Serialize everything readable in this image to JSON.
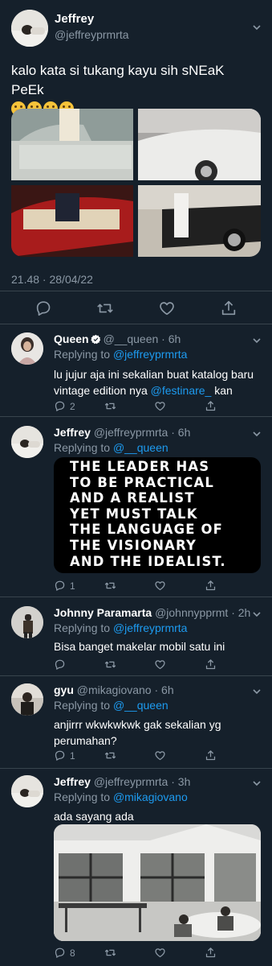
{
  "main_tweet": {
    "name": "Jeffrey",
    "handle": "@jeffreyprmrta",
    "text": "kalo kata si tukang kayu sih sNEaK PeEk",
    "emoji_count": 4,
    "emoji": "grimacing-hand-over-mouth",
    "timestamp": "21.48 · 28/04/22",
    "actions": [
      "reply-icon",
      "retweet-icon",
      "like-icon",
      "share-icon"
    ]
  },
  "replies": [
    {
      "name": "Queen",
      "verified": true,
      "meta": "@__queen · 6h",
      "replying_prefix": "Replying to",
      "replying_to": "@jeffreyprmrta",
      "text_before": "lu jujur aja ini sekalian buat katalog baru vintage edition nya ",
      "mention": "@festinare_",
      "text_after": " kan",
      "reply_count": "2",
      "retweet_count": "",
      "like_count": ""
    },
    {
      "name": "Jeffrey",
      "meta": "@jeffreyprmrta · 6h",
      "replying_prefix": "Replying to",
      "replying_to": "@__queen",
      "quote_lines": [
        "THE LEADER HAS",
        "TO BE PRACTICAL",
        "AND A REALIST",
        "YET MUST TALK",
        "THE LANGUAGE OF",
        "THE VISIONARY",
        "AND THE IDEALIST."
      ],
      "reply_count": "1"
    },
    {
      "name": "Johnny Paramarta",
      "meta": "@johnnypprmt · 2h",
      "replying_prefix": "Replying to",
      "replying_to": "@jeffreyprmrta",
      "text": "Bisa banget makelar mobil satu ini"
    },
    {
      "name": "gyu",
      "meta": "@mikagiovano · 6h",
      "replying_prefix": "Replying to",
      "replying_to": "@__queen",
      "text": "anjirrr wkwkwkwk gak sekalian yg perumahan?",
      "reply_count": "1"
    },
    {
      "name": "Jeffrey",
      "meta": "@jeffreyprmrta · 3h",
      "replying_prefix": "Replying to",
      "replying_to": "@mikagiovano",
      "text": "ada sayang ada",
      "reply_count": "8"
    }
  ],
  "colors": {
    "background": "#15202b",
    "text": "#ffffff",
    "secondary": "#8b98a5",
    "link": "#1d9bf0",
    "divider": "#38444d"
  }
}
